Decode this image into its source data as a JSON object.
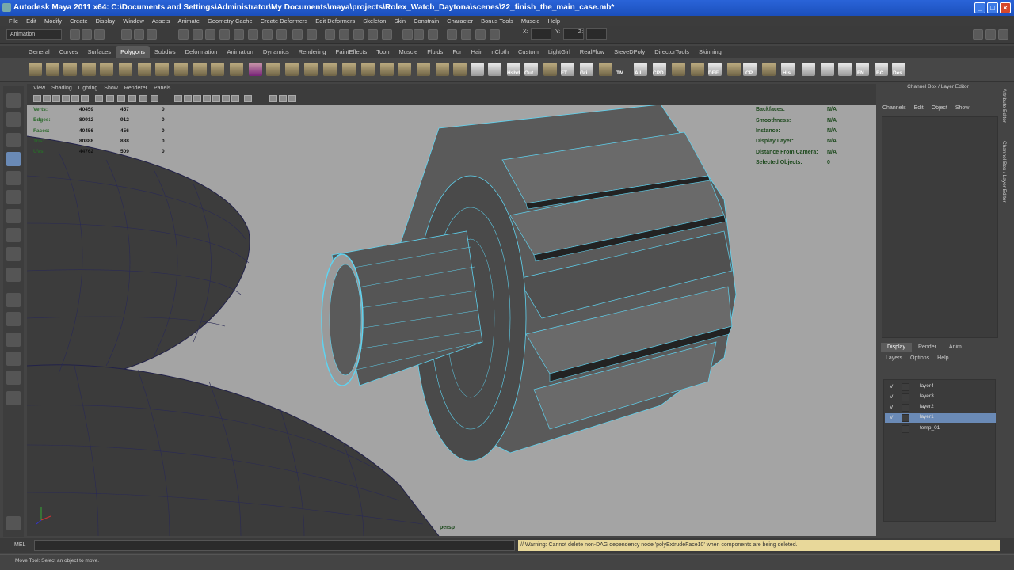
{
  "window": {
    "title": "Autodesk Maya 2011 x64: C:\\Documents and Settings\\Administrator\\My Documents\\maya\\projects\\Rolex_Watch_Daytona\\scenes\\22_finish_the_main_case.mb*",
    "minimize": "_",
    "maximize": "□",
    "close": "×"
  },
  "menubar": [
    "File",
    "Edit",
    "Modify",
    "Create",
    "Display",
    "Window",
    "Assets",
    "Animate",
    "Geometry Cache",
    "Create Deformers",
    "Edit Deformers",
    "Skeleton",
    "Skin",
    "Constrain",
    "Character",
    "Bonus Tools",
    "Muscle",
    "Help"
  ],
  "statusline": {
    "mode": "Animation",
    "x_label": "X:",
    "y_label": "Y:",
    "z_label": "Z:"
  },
  "shelf_tabs": [
    "General",
    "Curves",
    "Surfaces",
    "Polygons",
    "Subdivs",
    "Deformation",
    "Animation",
    "Dynamics",
    "Rendering",
    "PaintEffects",
    "Toon",
    "Muscle",
    "Fluids",
    "Fur",
    "Hair",
    "nCloth",
    "Custom",
    "LightGirl",
    "RealFlow",
    "SteveDPoly",
    "DirectorTools",
    "Skinning"
  ],
  "shelf_active_tab": "Polygons",
  "shelf_labels": [
    "Hshd",
    "Out",
    "FT",
    "Gri",
    "TM",
    "All",
    "CPD",
    "DEF",
    "CP",
    "His",
    "FN",
    "BC",
    "Des"
  ],
  "viewport": {
    "menu": [
      "View",
      "Shading",
      "Lighting",
      "Show",
      "Renderer",
      "Panels"
    ],
    "camera_label": "persp",
    "hud_left": [
      {
        "label": "Verts:",
        "v1": "40459",
        "v2": "457",
        "v3": "0"
      },
      {
        "label": "Edges:",
        "v1": "80912",
        "v2": "912",
        "v3": "0"
      },
      {
        "label": "Faces:",
        "v1": "40456",
        "v2": "456",
        "v3": "0"
      },
      {
        "label": "Tris:",
        "v1": "80888",
        "v2": "888",
        "v3": "0"
      },
      {
        "label": "UVs:",
        "v1": "44762",
        "v2": "509",
        "v3": "0"
      }
    ],
    "hud_right": [
      {
        "label": "Backfaces:",
        "value": "N/A"
      },
      {
        "label": "Smoothness:",
        "value": "N/A"
      },
      {
        "label": "Instance:",
        "value": "N/A"
      },
      {
        "label": "Display Layer:",
        "value": "N/A"
      },
      {
        "label": "Distance From Camera:",
        "value": "N/A"
      },
      {
        "label": "Selected Objects:",
        "value": "0"
      }
    ]
  },
  "channel_box": {
    "title": "Channel Box / Layer Editor",
    "menu": [
      "Channels",
      "Edit",
      "Object",
      "Show"
    ]
  },
  "layer_editor": {
    "tabs": [
      "Display",
      "Render",
      "Anim"
    ],
    "active_tab": "Display",
    "menu": [
      "Layers",
      "Options",
      "Help"
    ],
    "layers": [
      {
        "name": "layer4",
        "visible": "V",
        "selected": false
      },
      {
        "name": "layer3",
        "visible": "V",
        "selected": false
      },
      {
        "name": "layer2",
        "visible": "V",
        "selected": false
      },
      {
        "name": "layer1",
        "visible": "V",
        "selected": true
      },
      {
        "name": "temp_01",
        "visible": "",
        "selected": false
      }
    ]
  },
  "side_tabs": [
    "Attribute Editor",
    "Channel Box / Layer Editor"
  ],
  "command_line": {
    "label": "MEL",
    "warning": "// Warning: Cannot delete non-DAG dependency node 'polyExtrudeFace10' when components are being deleted."
  },
  "help_line": "Move Tool: Select an object to move.",
  "colors": {
    "selection_highlight": "#6a8ab6",
    "wire_highlight": "#5fd3f0",
    "warning_bg": "#e8d89a"
  }
}
